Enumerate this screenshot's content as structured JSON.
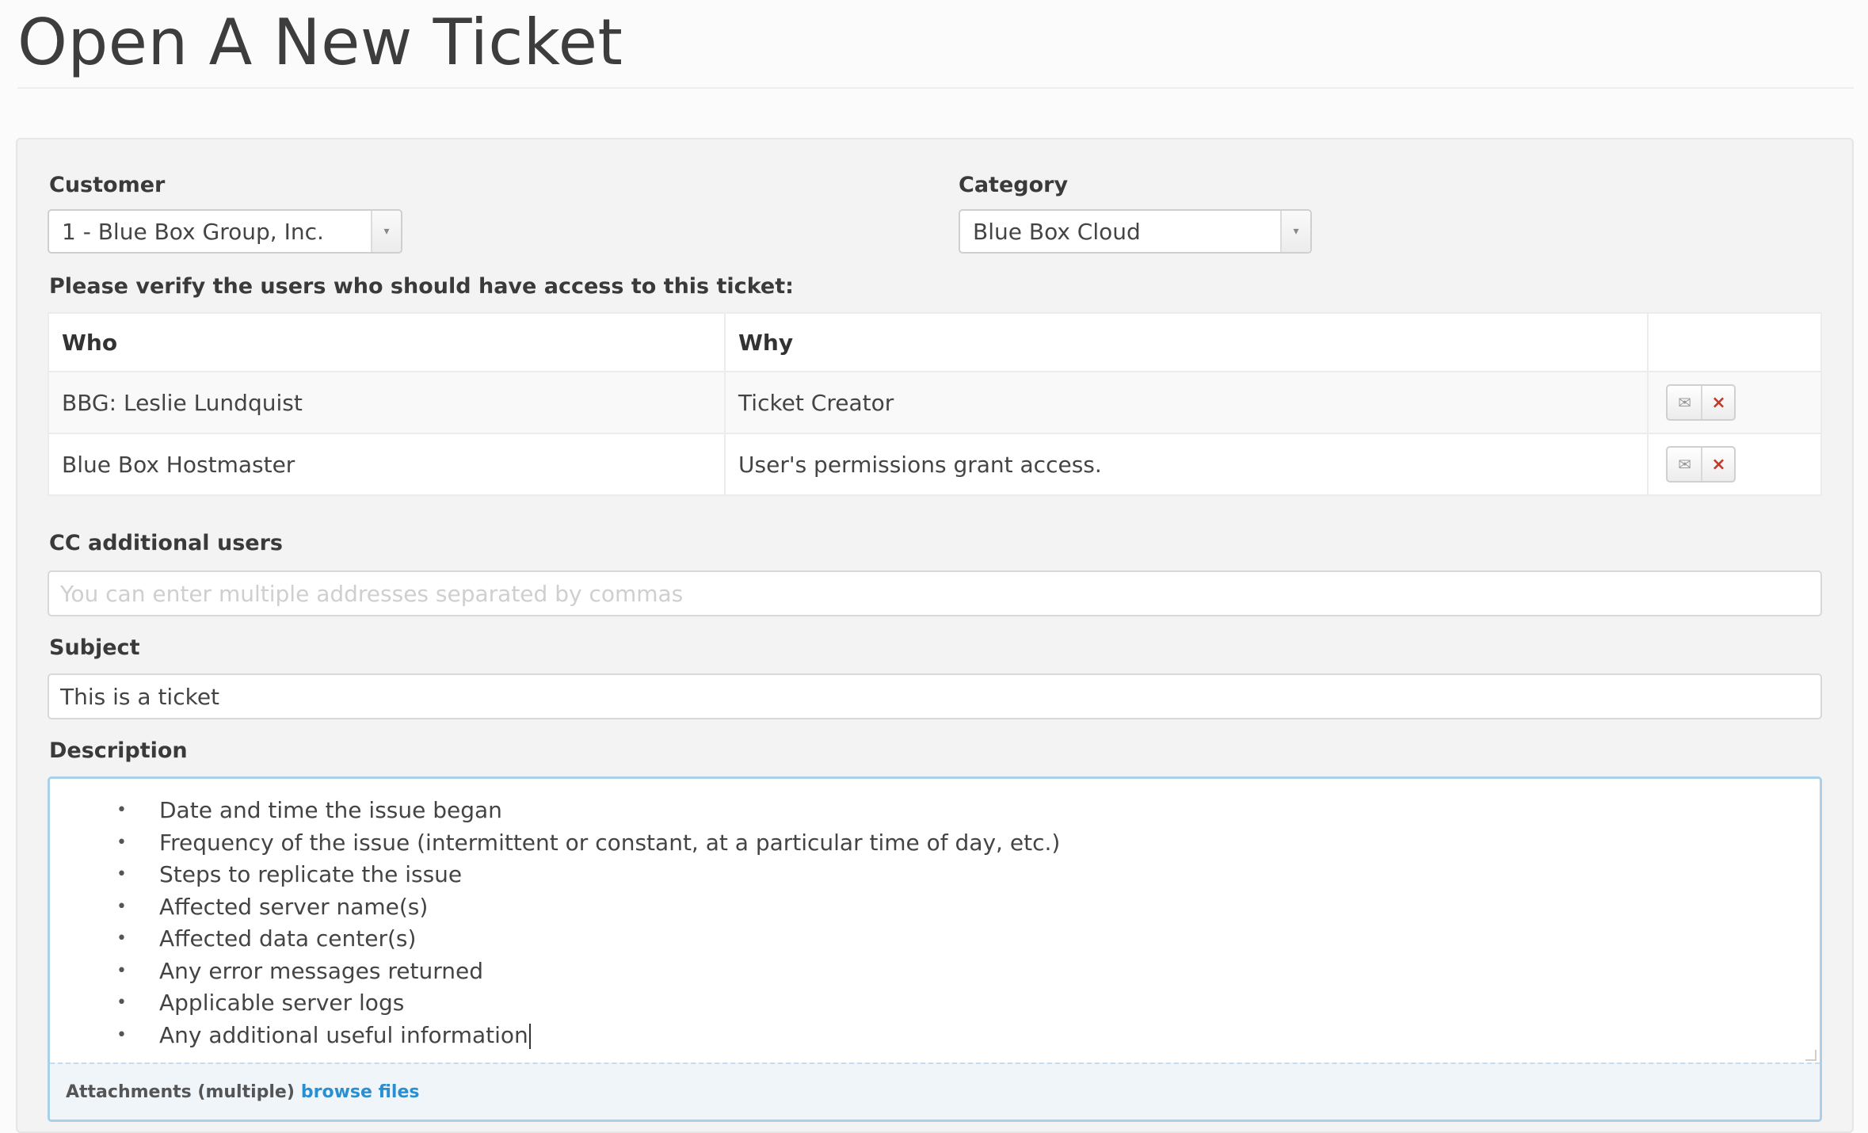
{
  "page": {
    "title": "Open A New Ticket"
  },
  "form": {
    "customer": {
      "label": "Customer",
      "value": "1 - Blue Box Group, Inc."
    },
    "category": {
      "label": "Category",
      "value": "Blue Box Cloud"
    },
    "access_prompt": "Please verify the users who should have access to this ticket:",
    "access_table": {
      "headers": {
        "who": "Who",
        "why": "Why"
      },
      "rows": [
        {
          "who": "BBG: Leslie Lundquist",
          "why": "Ticket Creator"
        },
        {
          "who": "Blue Box Hostmaster",
          "why": "User's permissions grant access."
        }
      ],
      "icons": {
        "email": "envelope-icon",
        "remove": "close-icon"
      }
    },
    "cc": {
      "label": "CC additional users",
      "placeholder": "You can enter multiple addresses separated by commas"
    },
    "subject": {
      "label": "Subject",
      "value": "This is a ticket"
    },
    "description": {
      "label": "Description",
      "bullets": [
        "Date and time the issue began",
        "Frequency of the issue (intermittent or constant, at a particular time of day, etc.)",
        "Steps to replicate the issue",
        "Affected server name(s)",
        "Affected data center(s)",
        "Any error messages returned",
        "Applicable server logs",
        "Any additional useful information"
      ]
    },
    "attachments": {
      "label": "Attachments (multiple)",
      "link": "browse files"
    }
  },
  "colors": {
    "accent_link": "#2a8fd0",
    "focus_border": "#a9cfe9",
    "remove_icon": "#c0392b"
  }
}
